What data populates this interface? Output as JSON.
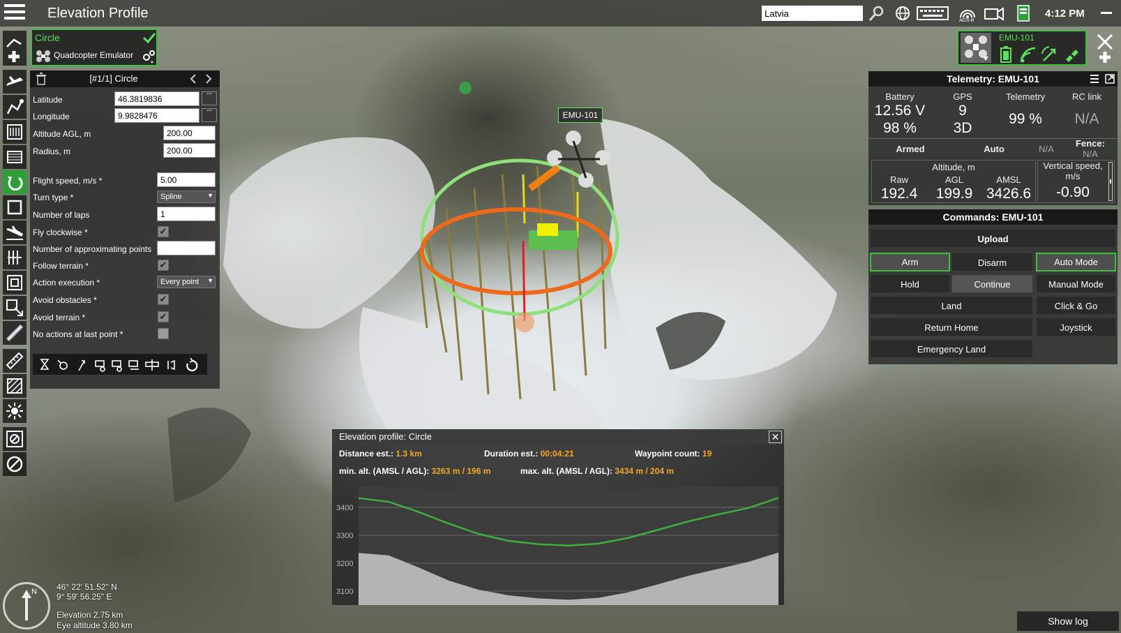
{
  "app": {
    "title": "Elevation Profile",
    "search_value": "Latvia",
    "clock": "4:12 PM",
    "ads_label": "ADS-B"
  },
  "route": {
    "name": "Circle",
    "vehicle": "Quadcopter Emulator"
  },
  "waypoint_panel": {
    "title": "[#1/1] Circle",
    "fields": [
      {
        "label": "Latitude",
        "value": "46.3819836"
      },
      {
        "label": "Longitude",
        "value": "9.9828476"
      },
      {
        "label": "Altitude AGL, m",
        "value": "200.00"
      },
      {
        "label": "Radius, m",
        "value": "200.00"
      },
      {
        "label": "Flight speed, m/s *",
        "value": "5.00"
      },
      {
        "label": "Turn type *",
        "value": "Spline"
      },
      {
        "label": "Number of laps",
        "value": "1"
      },
      {
        "label": "Fly clockwise *",
        "checked": true
      },
      {
        "label": "Number of approximating points",
        "value": ""
      },
      {
        "label": "Follow terrain *",
        "checked": true
      },
      {
        "label": "Action execution *",
        "value": "Every point"
      },
      {
        "label": "Avoid obstacles *",
        "checked": true
      },
      {
        "label": "Avoid terrain *",
        "checked": true
      },
      {
        "label": "No actions at last point *",
        "checked": false
      }
    ]
  },
  "map_label": "EMU-101",
  "vehicle_card": {
    "name": "EMU-101"
  },
  "telemetry": {
    "title": "Telemetry: EMU-101",
    "battery_label": "Battery",
    "battery_voltage": "12.56 V",
    "battery_percent": "98 %",
    "gps_label": "GPS",
    "gps_sats": "9",
    "gps_fix": "3D",
    "telemetry_label": "Telemetry",
    "telemetry_value": "99 %",
    "rclink_label": "RC link",
    "rclink_value": "N/A",
    "armed": "Armed",
    "mode": "Auto",
    "na": "N/A",
    "fence_label": "Fence:",
    "fence_value": "N/A",
    "altitude_title": "Altitude, m",
    "raw_label": "Raw",
    "raw_value": "192.4",
    "agl_label": "AGL",
    "agl_value": "199.9",
    "amsl_label": "AMSL",
    "amsl_value": "3426.6",
    "vspeed_label": "Vertical speed, m/s",
    "vspeed_value": "-0.90"
  },
  "commands": {
    "title": "Commands: EMU-101",
    "upload": "Upload",
    "arm": "Arm",
    "disarm": "Disarm",
    "auto_mode": "Auto Mode",
    "hold": "Hold",
    "continue": "Continue",
    "manual_mode": "Manual Mode",
    "land": "Land",
    "click_go": "Click & Go",
    "return_home": "Return Home",
    "joystick": "Joystick",
    "emergency_land": "Emergency Land"
  },
  "elevation": {
    "title": "Elevation profile: Circle",
    "distance_label": "Distance est.:",
    "distance_value": "1.3 km",
    "duration_label": "Duration est.:",
    "duration_value": "00:04:21",
    "waypoints_label": "Waypoint count:",
    "waypoints_value": "19",
    "min_label": "min. alt. (AMSL / AGL):",
    "min_value": "3263 m / 196 m",
    "max_label": "max. alt. (AMSL / AGL):",
    "max_value": "3434 m / 204 m",
    "chart_data": {
      "type": "area",
      "ylim": [
        3050,
        3475
      ],
      "yticks": [
        3100,
        3200,
        3300,
        3400
      ],
      "route_color": "#3fae3f",
      "terrain_color": "#b4b4b4",
      "route": [
        3433,
        3420,
        3384,
        3342,
        3305,
        3280,
        3268,
        3263,
        3270,
        3291,
        3320,
        3350,
        3375,
        3398,
        3434
      ],
      "terrain": [
        3237,
        3228,
        3185,
        3138,
        3105,
        3085,
        3074,
        3069,
        3076,
        3096,
        3125,
        3155,
        3180,
        3205,
        3238
      ]
    }
  },
  "map_info": {
    "lat": "46° 22' 51.52\" N",
    "lon": "9° 59' 56.25\" E",
    "elevation": "Elevation 2.75 km",
    "eye_altitude": "Eye altitude 3.80 km"
  },
  "show_log": "Show log",
  "colors": {
    "accent": "#3fbf3f",
    "highlight": "#f5a623"
  }
}
